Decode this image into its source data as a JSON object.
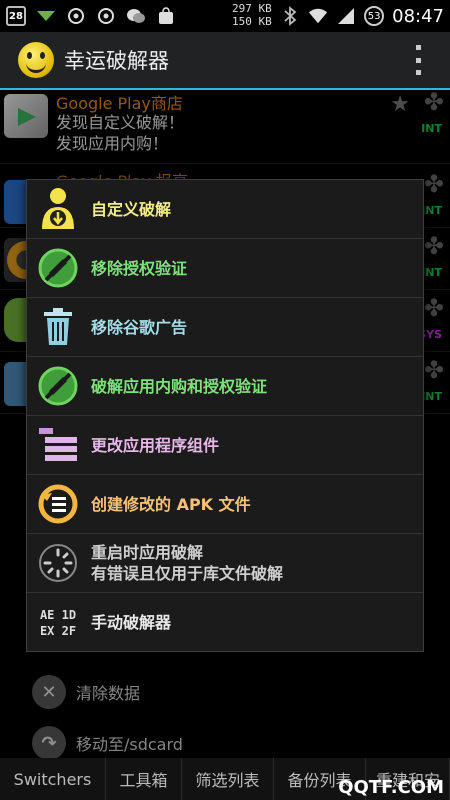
{
  "status_bar": {
    "calendar_day": "28",
    "net_up": "297 KB",
    "net_down": "150 KB",
    "battery": "53",
    "time": "08:47",
    "icons": [
      "calendar-icon",
      "signal-arrow-icon",
      "cl-app-icon",
      "cl-app-icon",
      "wechat-icon",
      "store-bag-icon",
      "bluetooth-icon",
      "wifi-icon",
      "cell-signal-icon"
    ]
  },
  "app_bar": {
    "title": "幸运破解器"
  },
  "background_list": {
    "row1_title": "Google Play商店",
    "row1_sub1": "发现自定义破解！",
    "row1_sub2": "发现应用内购！",
    "row1_tag": "INT",
    "row2_title": "Google Play 报亭",
    "row2_tag": "INT",
    "row3_tag": "INT",
    "row4_tag": "SYS",
    "row5_tag": "INT",
    "lower_items": [
      {
        "label": "清除数据"
      },
      {
        "label": "移动至/sdcard"
      }
    ]
  },
  "menu": {
    "items": [
      {
        "label": "自定义破解"
      },
      {
        "label": "移除授权验证"
      },
      {
        "label": "移除谷歌广告"
      },
      {
        "label": "破解应用内购和授权验证"
      },
      {
        "label": "更改应用程序组件"
      },
      {
        "label": "创建修改的 APK 文件"
      },
      {
        "label": "重启时应用破解",
        "sub": "有错误且仅用于库文件破解"
      },
      {
        "label": "手动破解器",
        "icon_text1": "AE 1D",
        "icon_text2": "EX 2F"
      }
    ]
  },
  "tabs": [
    "Switchers",
    "工具箱",
    "筛选列表",
    "备份列表",
    "重建和安"
  ],
  "watermark": "QQTF.COM",
  "colors": {
    "accent": "#33b5e5",
    "menu_yellow": "#f3ec8a",
    "menu_green": "#7fe07c",
    "menu_cyan": "#a5dde8",
    "menu_pink": "#e6b7e8",
    "menu_orange": "#f7c17a",
    "title_orange": "#e08a1e"
  }
}
